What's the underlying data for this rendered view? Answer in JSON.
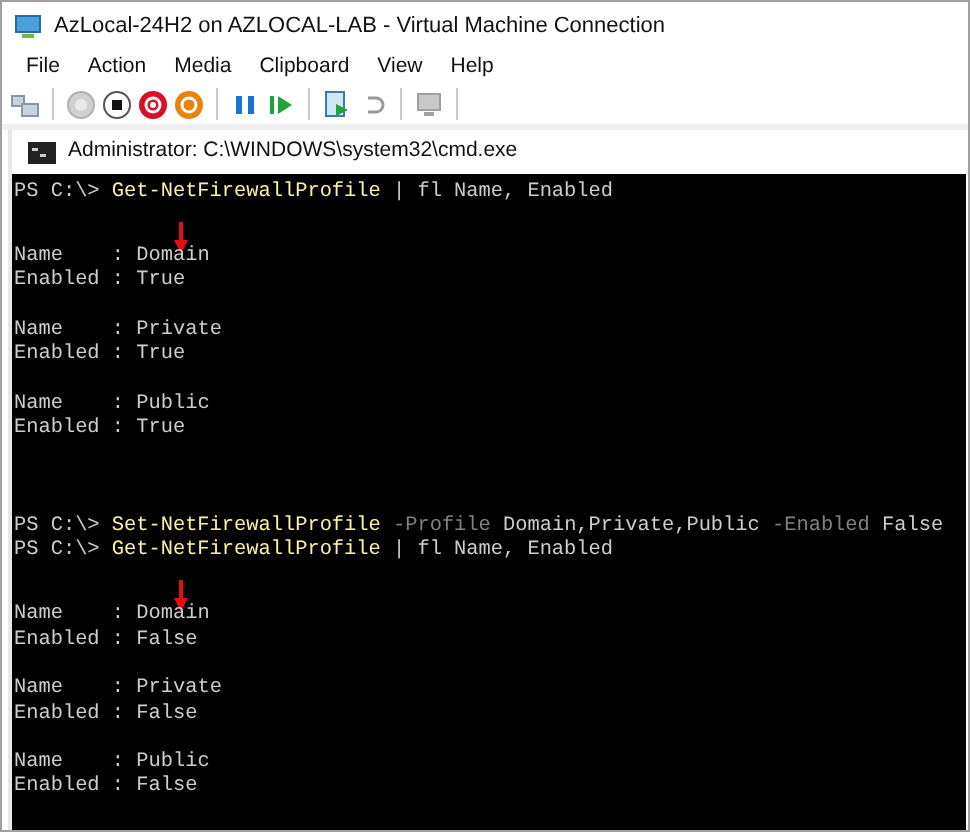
{
  "window": {
    "title": "AzLocal-24H2 on AZLOCAL-LAB - Virtual Machine Connection"
  },
  "menu": [
    "File",
    "Action",
    "Media",
    "Clipboard",
    "View",
    "Help"
  ],
  "toolbar": [
    {
      "kind": "ctrl-alt-del"
    },
    {
      "kind": "sep"
    },
    {
      "kind": "start"
    },
    {
      "kind": "turn-off"
    },
    {
      "kind": "shut-down"
    },
    {
      "kind": "save"
    },
    {
      "kind": "sep"
    },
    {
      "kind": "pause"
    },
    {
      "kind": "reset"
    },
    {
      "kind": "sep"
    },
    {
      "kind": "checkpoint"
    },
    {
      "kind": "revert"
    },
    {
      "kind": "sep"
    },
    {
      "kind": "enhanced"
    },
    {
      "kind": "sep"
    }
  ],
  "console": {
    "title": "Administrator: C:\\WINDOWS\\system32\\cmd.exe",
    "lines": [
      {
        "kind": "command",
        "prompt": "PS C:\\>",
        "tokens": [
          {
            "kind": "cmdlet",
            "text": "Get-NetFirewallProfile"
          },
          {
            "kind": "argument",
            "text": "|"
          },
          {
            "kind": "argument",
            "text": "fl"
          },
          {
            "kind": "argument",
            "text": "Name,"
          },
          {
            "kind": "argument",
            "text": "Enabled"
          }
        ]
      },
      {
        "kind": "blank"
      },
      {
        "kind": "arrow"
      },
      {
        "kind": "output",
        "text": "Name    : Domain"
      },
      {
        "kind": "output",
        "text": "Enabled : True"
      },
      {
        "kind": "blank"
      },
      {
        "kind": "output",
        "text": "Name    : Private"
      },
      {
        "kind": "output",
        "text": "Enabled : True"
      },
      {
        "kind": "blank"
      },
      {
        "kind": "output",
        "text": "Name    : Public"
      },
      {
        "kind": "output",
        "text": "Enabled : True"
      },
      {
        "kind": "blank"
      },
      {
        "kind": "blank"
      },
      {
        "kind": "blank"
      },
      {
        "kind": "command",
        "prompt": "PS C:\\>",
        "tokens": [
          {
            "kind": "cmdlet",
            "text": "Set-NetFirewallProfile"
          },
          {
            "kind": "parameter",
            "text": "-Profile"
          },
          {
            "kind": "argument",
            "text": "Domain,Private,Public"
          },
          {
            "kind": "parameter",
            "text": "-Enabled"
          },
          {
            "kind": "argument",
            "text": "False"
          }
        ]
      },
      {
        "kind": "command",
        "prompt": "PS C:\\>",
        "tokens": [
          {
            "kind": "cmdlet",
            "text": "Get-NetFirewallProfile"
          },
          {
            "kind": "argument",
            "text": "|"
          },
          {
            "kind": "argument",
            "text": "fl"
          },
          {
            "kind": "argument",
            "text": "Name,"
          },
          {
            "kind": "argument",
            "text": "Enabled"
          }
        ]
      },
      {
        "kind": "blank"
      },
      {
        "kind": "arrow"
      },
      {
        "kind": "output",
        "text": "Name    : Domain"
      },
      {
        "kind": "output",
        "text": "Enabled : False"
      },
      {
        "kind": "blank"
      },
      {
        "kind": "output",
        "text": "Name    : Private"
      },
      {
        "kind": "output",
        "text": "Enabled : False"
      },
      {
        "kind": "blank"
      },
      {
        "kind": "output",
        "text": "Name    : Public"
      },
      {
        "kind": "output",
        "text": "Enabled : False"
      }
    ]
  }
}
